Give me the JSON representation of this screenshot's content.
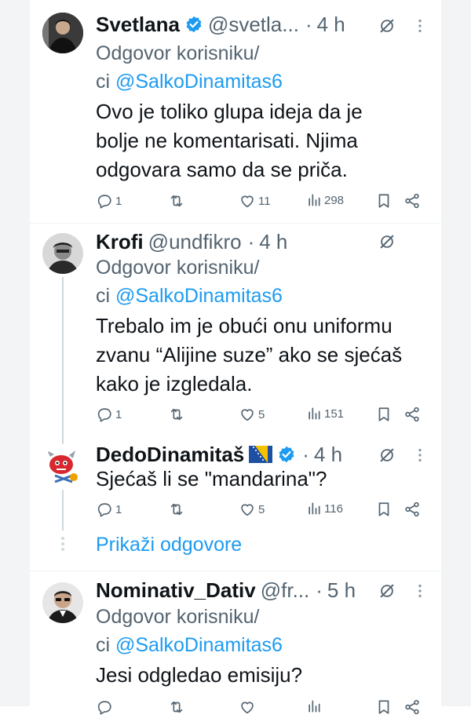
{
  "tweets": [
    {
      "name": "Svetlana",
      "handle": "@svetla...",
      "time": "4 h",
      "reply_prefix": "Odgovor korisniku/",
      "reply_ci": "ci ",
      "reply_mention": "@SalkoDinamitas6",
      "lines": [
        "Ovo je toliko glupa ideja da je",
        "bolje ne komentarisati.  Njima",
        "odgovara samo da se priča."
      ],
      "replies": "1",
      "likes": "11",
      "views": "298"
    },
    {
      "name": "Krofi",
      "handle": "@undfikro",
      "time": "4 h",
      "reply_prefix": "Odgovor korisniku/",
      "reply_ci": "ci ",
      "reply_mention": "@SalkoDinamitas6",
      "lines": [
        "Trebalo im je obući onu uniformu",
        "zvanu “Alijine suze” ako se sjećaš",
        "kako je izgledala."
      ],
      "replies": "1",
      "likes": "5",
      "views": "151"
    },
    {
      "name": "DedoDinamitaš",
      "handle": "",
      "time": "4 h",
      "lines": [
        "Sjećaš li se \"mandarina\"?"
      ],
      "replies": "1",
      "likes": "5",
      "views": "116"
    },
    {
      "name": "Nominativ_Dativ",
      "handle": "@fr...",
      "time": "5 h",
      "reply_prefix": "Odgovor korisniku/",
      "reply_ci": "ci ",
      "reply_mention": "@SalkoDinamitas6",
      "lines": [
        "Jesi odgledao emisiju?"
      ]
    }
  ],
  "show_replies": "Prikaži odgovore",
  "separator_dot": "·",
  "icons": {
    "reply": "reply-icon",
    "retweet": "retweet-icon",
    "like": "heart-icon",
    "views": "views-icon",
    "bookmark": "bookmark-icon",
    "share": "share-icon",
    "verified": "verified-badge-icon",
    "flag": "bosnia-flag-icon",
    "grok": "grok-icon",
    "more": "more-icon"
  },
  "colors": {
    "text": "#0f1419",
    "muted": "#536471",
    "link": "#1d9bf0",
    "verified": "#1d9bf0"
  }
}
